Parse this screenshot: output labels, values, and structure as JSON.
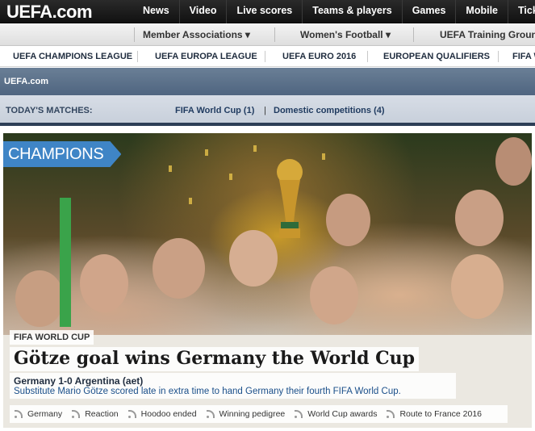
{
  "topbar": {
    "logo": "UEFA.com",
    "nav": [
      "News",
      "Video",
      "Live scores",
      "Teams & players",
      "Games",
      "Mobile",
      "Tick"
    ]
  },
  "subbar": {
    "items": [
      "Member Associations ▾",
      "Women's Football ▾",
      "UEFA Training Ground"
    ]
  },
  "compbar": {
    "items": [
      "UEFA CHAMPIONS LEAGUE",
      "UEFA EUROPA LEAGUE",
      "UEFA EURO 2016",
      "EUROPEAN QUALIFIERS",
      "FIFA W"
    ]
  },
  "breadcrumb": "UEFA.com",
  "matches": {
    "label": "TODAY'S MATCHES:",
    "world_cup": "FIFA World Cup (1)",
    "separator": "|",
    "domestic": "Domestic competitions (4)"
  },
  "hero": {
    "badge": "CHAMPIONS",
    "kicker": "FIFA WORLD CUP",
    "headline": "Götze goal wins Germany the World Cup",
    "score": "Germany 1-0 Argentina (aet)",
    "summary": "Substitute Mario Götze scored late in extra time to hand Germany their fourth FIFA World Cup.",
    "related": [
      "Germany",
      "Reaction",
      "Hoodoo ended",
      "Winning pedigree",
      "World Cup awards",
      "Route to France 2016"
    ]
  },
  "colors": {
    "accent": "#3f85c6",
    "topbar": "#1a1a1a",
    "link": "#1a4f8a"
  }
}
